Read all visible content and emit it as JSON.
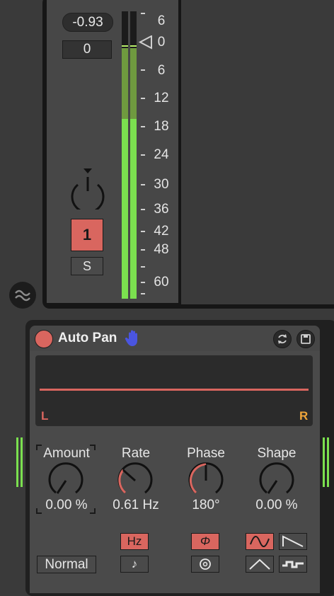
{
  "mixer": {
    "volume_readout": "-0.93",
    "pan_readout": "0",
    "track_number": "1",
    "solo_label": "S",
    "meter_scale": [
      "6",
      "0",
      "6",
      "12",
      "18",
      "24",
      "30",
      "36",
      "42",
      "48",
      "60"
    ],
    "meter_level": 0.62
  },
  "device": {
    "title": "Auto Pan",
    "display": {
      "left_label": "L",
      "right_label": "R"
    },
    "knobs": [
      {
        "label": "Amount",
        "value": "0.00 %"
      },
      {
        "label": "Rate",
        "value": "0.61 Hz"
      },
      {
        "label": "Phase",
        "value": "180°"
      },
      {
        "label": "Shape",
        "value": "0.00 %"
      }
    ],
    "buttons": {
      "hz": "Hz",
      "note": "♪",
      "phase": "Φ",
      "mode": "Normal"
    }
  },
  "colors": {
    "accent": "#d9665f",
    "meter_green": "#7be04f",
    "meter_dim": "#6f9a3f",
    "orange": "#f0a63a",
    "hand": "#4a55e0"
  }
}
